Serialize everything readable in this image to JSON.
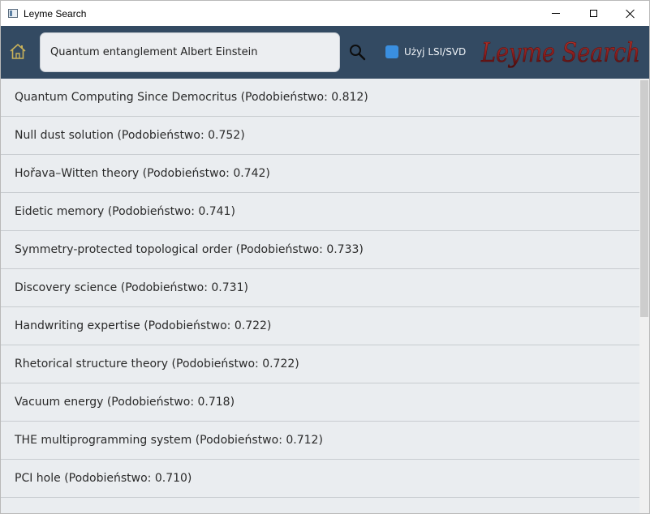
{
  "window": {
    "title": "Leyme Search",
    "icon": "app-window-icon",
    "controls": [
      "minimize-icon",
      "maximize-icon",
      "close-icon"
    ]
  },
  "toolbar": {
    "home_icon": "home-icon",
    "search": {
      "value": "Quantum entanglement Albert Einstein",
      "placeholder": ""
    },
    "search_icon": "search-icon",
    "lsi_checkbox": {
      "label": "Użyj LSI/SVD",
      "checked": true
    },
    "logo_text": "Leyme Search"
  },
  "results": [
    {
      "label": "Quantum Computing Since Democritus (Podobieństwo: 0.812)"
    },
    {
      "label": "Null dust solution (Podobieństwo: 0.752)"
    },
    {
      "label": "Hořava–Witten theory (Podobieństwo: 0.742)"
    },
    {
      "label": "Eidetic memory (Podobieństwo: 0.741)"
    },
    {
      "label": "Symmetry-protected topological order (Podobieństwo: 0.733)"
    },
    {
      "label": "Discovery science (Podobieństwo: 0.731)"
    },
    {
      "label": "Handwriting expertise (Podobieństwo: 0.722)"
    },
    {
      "label": "Rhetorical structure theory (Podobieństwo: 0.722)"
    },
    {
      "label": "Vacuum energy (Podobieństwo: 0.718)"
    },
    {
      "label": "THE multiprogramming system (Podobieństwo: 0.712)"
    },
    {
      "label": "PCI hole (Podobieństwo: 0.710)"
    }
  ],
  "colors": {
    "toolbar_bg": "#334a62",
    "list_bg": "#eaedf0",
    "checkbox": "#3a8fe0",
    "logo": "#8b1e1e"
  }
}
